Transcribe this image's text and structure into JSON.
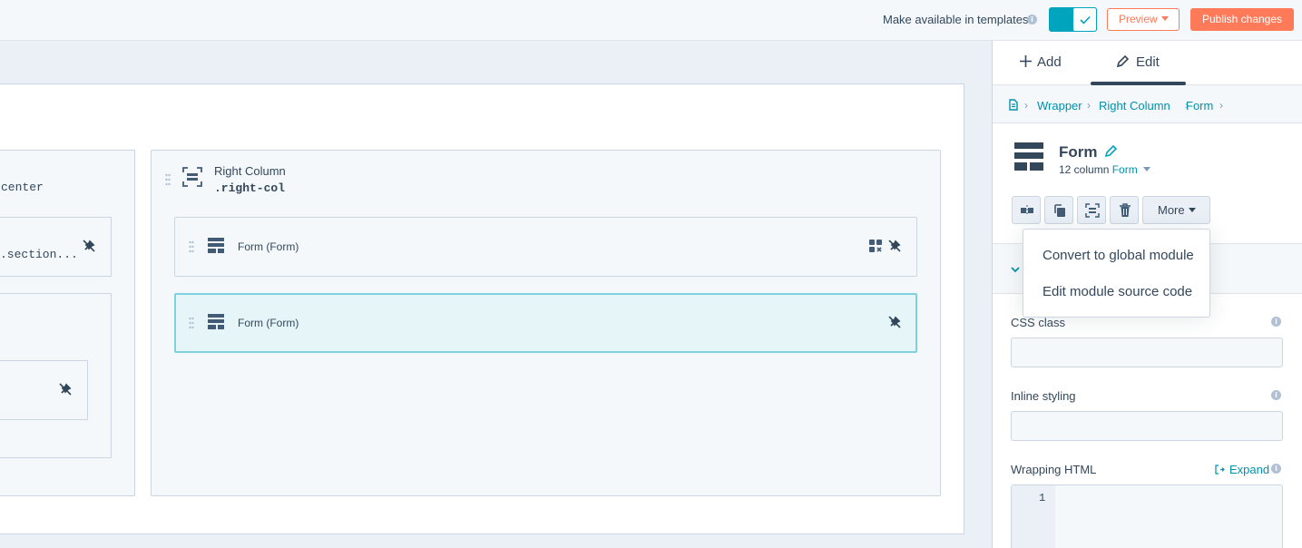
{
  "topbar": {
    "templates_label": "Make available in templates",
    "templates_enabled": true,
    "preview_label": "Preview",
    "publish_label": "Publish changes"
  },
  "canvas": {
    "left_col_class_partial": "center",
    "section_class_partial": ".section...",
    "right_col_title": "Right Column",
    "right_col_class": ".right-col",
    "modules": [
      {
        "label": "Form (Form)",
        "selected": false
      },
      {
        "label": "Form (Form)",
        "selected": true
      }
    ]
  },
  "sidebar": {
    "tab_add": "Add",
    "tab_edit": "Edit",
    "breadcrumb": [
      "Wrapper",
      "Right Column",
      "Form"
    ],
    "module_title": "Form",
    "module_width": "12 column",
    "module_type": "Form",
    "more_label": "More",
    "dropdown_items": [
      "Convert to global module",
      "Edit module source code"
    ],
    "css_class_label": "CSS class",
    "css_class_value": "",
    "inline_styling_label": "Inline styling",
    "inline_styling_value": "",
    "wrapping_html_label": "Wrapping HTML",
    "expand_label": "Expand",
    "code_line": "1"
  },
  "colors": {
    "accent": "#00a4bd",
    "link": "#0091ae",
    "publish": "#ff7a59",
    "text": "#33475b"
  }
}
